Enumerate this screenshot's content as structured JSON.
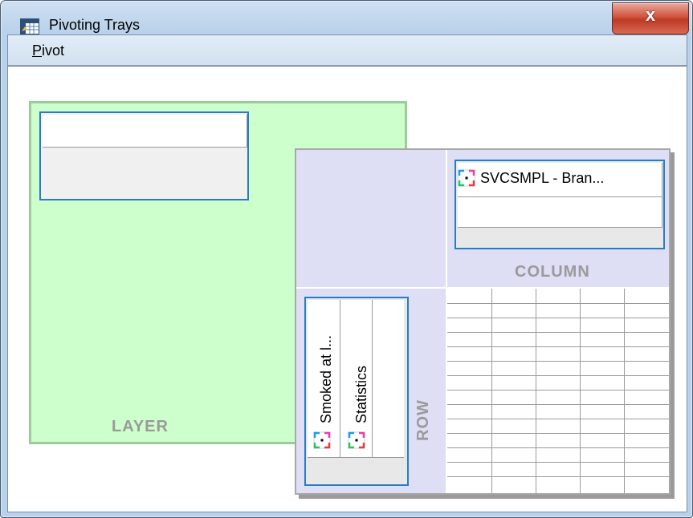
{
  "window": {
    "title": "Pivoting Trays",
    "close_label": "x"
  },
  "menu": {
    "pivot": {
      "accelerator": "P",
      "rest": "ivot"
    }
  },
  "trays": {
    "layer_label": "LAYER",
    "column_label": "COLUMN",
    "row_label": "ROW"
  },
  "column_items": [
    {
      "label": "SVCSMPL - Bran...",
      "icon": "variable-icon"
    }
  ],
  "row_items": [
    {
      "label": "Smoked at l...",
      "icon": "variable-icon"
    },
    {
      "label": "Statistics",
      "icon": "variable-icon"
    }
  ],
  "colors": {
    "layer_bg": "#ccffcc",
    "pivot_bg": "#dedef5",
    "tray_border": "#2b7bc0",
    "label_gray": "#9a9a9a",
    "close_red": "#c94430"
  }
}
